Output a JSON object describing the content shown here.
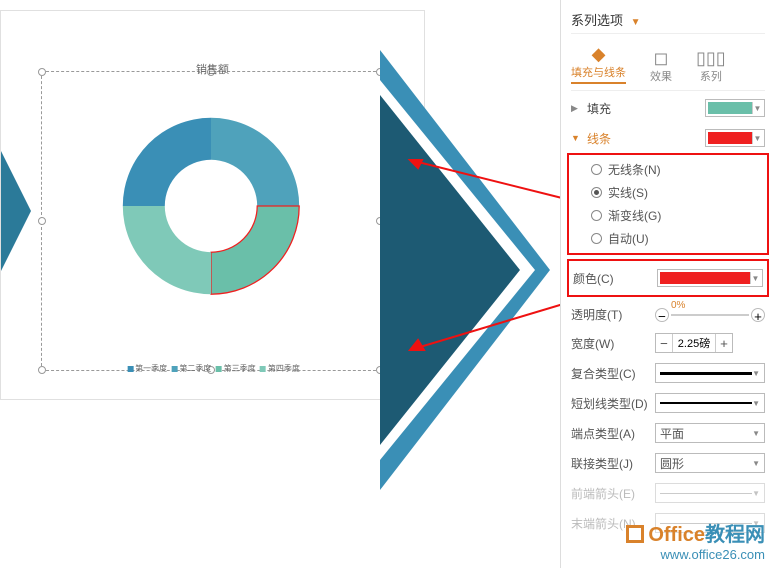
{
  "panel_title": "系列选项",
  "tabs": {
    "fill_line": "填充与线条",
    "effect": "效果",
    "series": "系列"
  },
  "fill": {
    "header": "填充",
    "swatch_color": "#6abfa9"
  },
  "line": {
    "header": "线条",
    "swatch_color": "#ef2020",
    "options": {
      "none": "无线条(N)",
      "solid": "实线(S)",
      "gradient": "渐变线(G)",
      "auto": "自动(U)"
    },
    "color_label": "颜色(C)",
    "color_value": "#ef2020",
    "transparency_label": "透明度(T)",
    "transparency_value": "0%",
    "width_label": "宽度(W)",
    "width_value": "2.25磅",
    "compound_label": "复合类型(C)",
    "dash_label": "短划线类型(D)",
    "cap_label": "端点类型(A)",
    "cap_value": "平面",
    "join_label": "联接类型(J)",
    "join_value": "圆形",
    "begin_arrow_label": "前端箭头(E)",
    "end_arrow_label": "末端箭头(N)"
  },
  "chart": {
    "title": "销售额",
    "legend_items": [
      "第一季度",
      "第二季度",
      "第三季度",
      "第四季度"
    ]
  },
  "chart_data": {
    "type": "pie",
    "title": "销售额",
    "categories": [
      "第一季度",
      "第二季度",
      "第三季度",
      "第四季度"
    ],
    "values": [
      25,
      25,
      25,
      25
    ],
    "inner_radius_pct": 55,
    "colors": [
      "#3a8fb6",
      "#4fa2bb",
      "#6abfa9",
      "#7fc9b8"
    ]
  },
  "watermark": {
    "brand": "Office教程网",
    "url": "www.office26.com"
  }
}
